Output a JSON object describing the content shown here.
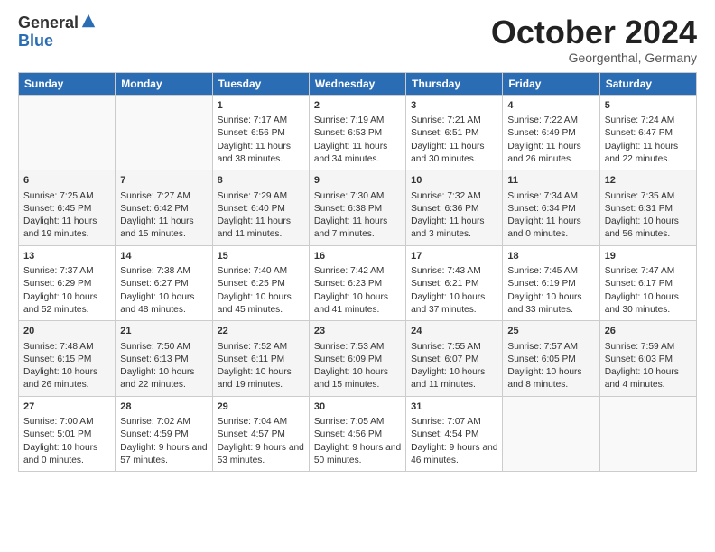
{
  "logo": {
    "general": "General",
    "blue": "Blue"
  },
  "title": "October 2024",
  "subtitle": "Georgenthal, Germany",
  "days_of_week": [
    "Sunday",
    "Monday",
    "Tuesday",
    "Wednesday",
    "Thursday",
    "Friday",
    "Saturday"
  ],
  "weeks": [
    [
      {
        "day": "",
        "text": ""
      },
      {
        "day": "",
        "text": ""
      },
      {
        "day": "1",
        "text": "Sunrise: 7:17 AM\nSunset: 6:56 PM\nDaylight: 11 hours and 38 minutes."
      },
      {
        "day": "2",
        "text": "Sunrise: 7:19 AM\nSunset: 6:53 PM\nDaylight: 11 hours and 34 minutes."
      },
      {
        "day": "3",
        "text": "Sunrise: 7:21 AM\nSunset: 6:51 PM\nDaylight: 11 hours and 30 minutes."
      },
      {
        "day": "4",
        "text": "Sunrise: 7:22 AM\nSunset: 6:49 PM\nDaylight: 11 hours and 26 minutes."
      },
      {
        "day": "5",
        "text": "Sunrise: 7:24 AM\nSunset: 6:47 PM\nDaylight: 11 hours and 22 minutes."
      }
    ],
    [
      {
        "day": "6",
        "text": "Sunrise: 7:25 AM\nSunset: 6:45 PM\nDaylight: 11 hours and 19 minutes."
      },
      {
        "day": "7",
        "text": "Sunrise: 7:27 AM\nSunset: 6:42 PM\nDaylight: 11 hours and 15 minutes."
      },
      {
        "day": "8",
        "text": "Sunrise: 7:29 AM\nSunset: 6:40 PM\nDaylight: 11 hours and 11 minutes."
      },
      {
        "day": "9",
        "text": "Sunrise: 7:30 AM\nSunset: 6:38 PM\nDaylight: 11 hours and 7 minutes."
      },
      {
        "day": "10",
        "text": "Sunrise: 7:32 AM\nSunset: 6:36 PM\nDaylight: 11 hours and 3 minutes."
      },
      {
        "day": "11",
        "text": "Sunrise: 7:34 AM\nSunset: 6:34 PM\nDaylight: 11 hours and 0 minutes."
      },
      {
        "day": "12",
        "text": "Sunrise: 7:35 AM\nSunset: 6:31 PM\nDaylight: 10 hours and 56 minutes."
      }
    ],
    [
      {
        "day": "13",
        "text": "Sunrise: 7:37 AM\nSunset: 6:29 PM\nDaylight: 10 hours and 52 minutes."
      },
      {
        "day": "14",
        "text": "Sunrise: 7:38 AM\nSunset: 6:27 PM\nDaylight: 10 hours and 48 minutes."
      },
      {
        "day": "15",
        "text": "Sunrise: 7:40 AM\nSunset: 6:25 PM\nDaylight: 10 hours and 45 minutes."
      },
      {
        "day": "16",
        "text": "Sunrise: 7:42 AM\nSunset: 6:23 PM\nDaylight: 10 hours and 41 minutes."
      },
      {
        "day": "17",
        "text": "Sunrise: 7:43 AM\nSunset: 6:21 PM\nDaylight: 10 hours and 37 minutes."
      },
      {
        "day": "18",
        "text": "Sunrise: 7:45 AM\nSunset: 6:19 PM\nDaylight: 10 hours and 33 minutes."
      },
      {
        "day": "19",
        "text": "Sunrise: 7:47 AM\nSunset: 6:17 PM\nDaylight: 10 hours and 30 minutes."
      }
    ],
    [
      {
        "day": "20",
        "text": "Sunrise: 7:48 AM\nSunset: 6:15 PM\nDaylight: 10 hours and 26 minutes."
      },
      {
        "day": "21",
        "text": "Sunrise: 7:50 AM\nSunset: 6:13 PM\nDaylight: 10 hours and 22 minutes."
      },
      {
        "day": "22",
        "text": "Sunrise: 7:52 AM\nSunset: 6:11 PM\nDaylight: 10 hours and 19 minutes."
      },
      {
        "day": "23",
        "text": "Sunrise: 7:53 AM\nSunset: 6:09 PM\nDaylight: 10 hours and 15 minutes."
      },
      {
        "day": "24",
        "text": "Sunrise: 7:55 AM\nSunset: 6:07 PM\nDaylight: 10 hours and 11 minutes."
      },
      {
        "day": "25",
        "text": "Sunrise: 7:57 AM\nSunset: 6:05 PM\nDaylight: 10 hours and 8 minutes."
      },
      {
        "day": "26",
        "text": "Sunrise: 7:59 AM\nSunset: 6:03 PM\nDaylight: 10 hours and 4 minutes."
      }
    ],
    [
      {
        "day": "27",
        "text": "Sunrise: 7:00 AM\nSunset: 5:01 PM\nDaylight: 10 hours and 0 minutes."
      },
      {
        "day": "28",
        "text": "Sunrise: 7:02 AM\nSunset: 4:59 PM\nDaylight: 9 hours and 57 minutes."
      },
      {
        "day": "29",
        "text": "Sunrise: 7:04 AM\nSunset: 4:57 PM\nDaylight: 9 hours and 53 minutes."
      },
      {
        "day": "30",
        "text": "Sunrise: 7:05 AM\nSunset: 4:56 PM\nDaylight: 9 hours and 50 minutes."
      },
      {
        "day": "31",
        "text": "Sunrise: 7:07 AM\nSunset: 4:54 PM\nDaylight: 9 hours and 46 minutes."
      },
      {
        "day": "",
        "text": ""
      },
      {
        "day": "",
        "text": ""
      }
    ]
  ]
}
